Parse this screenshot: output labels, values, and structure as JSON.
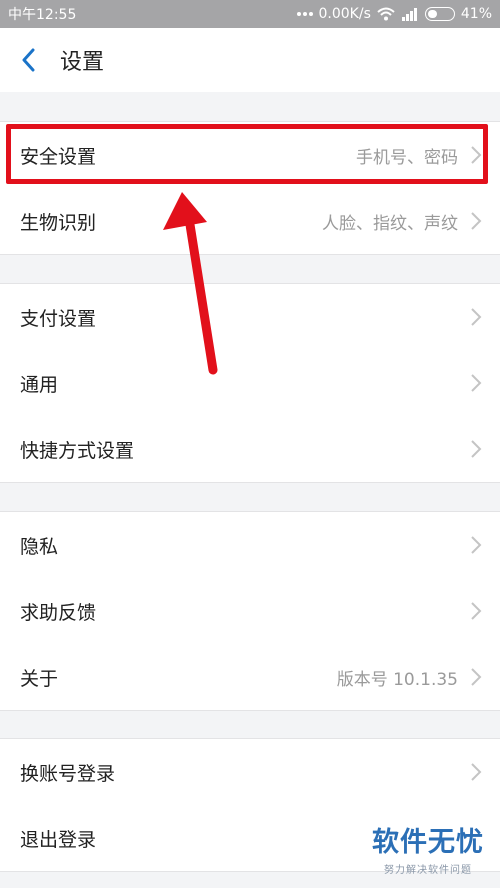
{
  "status_bar": {
    "time": "中午12:55",
    "network_speed": "0.00K/s",
    "battery": "41%",
    "battery_level": 0.41
  },
  "header": {
    "title": "设置"
  },
  "groups": [
    {
      "items": [
        {
          "label": "安全设置",
          "value": "手机号、密码"
        },
        {
          "label": "生物识别",
          "value": "人脸、指纹、声纹"
        }
      ]
    },
    {
      "items": [
        {
          "label": "支付设置",
          "value": ""
        },
        {
          "label": "通用",
          "value": ""
        },
        {
          "label": "快捷方式设置",
          "value": ""
        }
      ]
    },
    {
      "items": [
        {
          "label": "隐私",
          "value": ""
        },
        {
          "label": "求助反馈",
          "value": ""
        },
        {
          "label": "关于",
          "value": "版本号 10.1.35"
        }
      ]
    },
    {
      "items": [
        {
          "label": "换账号登录",
          "value": ""
        },
        {
          "label": "退出登录",
          "value": ""
        }
      ]
    }
  ],
  "annotation": {
    "color": "#e2101b"
  },
  "watermark": {
    "main": "软件无忧",
    "sub": "努力解决软件问题"
  },
  "colors": {
    "accent": "#1a73c8",
    "background": "#f3f4f6"
  },
  "icons": [
    "back-arrow-icon",
    "chevron-right-icon",
    "wifi-icon",
    "signal-icon",
    "battery-icon"
  ]
}
